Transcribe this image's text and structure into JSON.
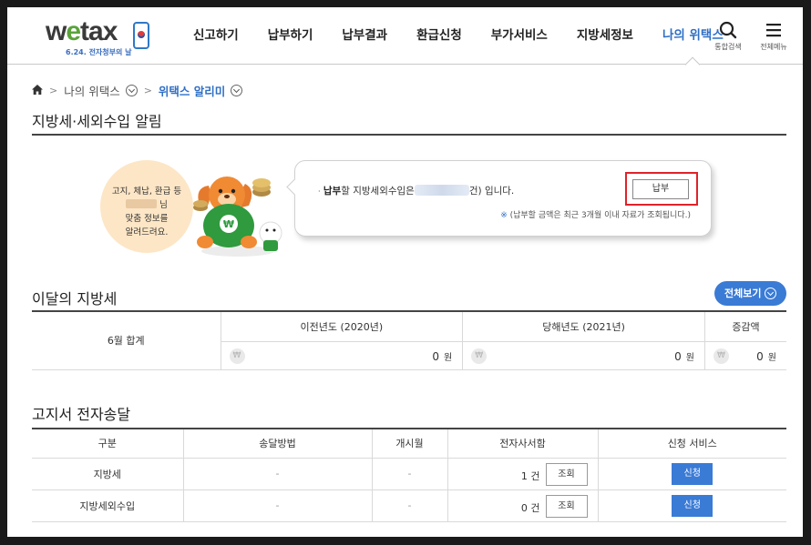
{
  "header": {
    "logo_word_pre": "w",
    "logo_word_e": "e",
    "logo_word_post": "tax",
    "logo_sub": "6.24. 전자청부의 날",
    "nav": [
      "신고하기",
      "납부하기",
      "납부결과",
      "환급신청",
      "부가서비스",
      "지방세정보",
      "나의 위택스"
    ],
    "active_nav": "나의 위택스",
    "search_label": "통합검색",
    "menu_label": "전체메뉴"
  },
  "breadcrumb": {
    "level1": "나의 위택스",
    "current": "위택스 알리미"
  },
  "notice": {
    "section_title": "지방세·세외수입 알림",
    "bubble_line1": "고지, 체납, 환급 등",
    "bubble_line2": "님",
    "bubble_line3": "맞춤 정보를",
    "bubble_line4": "알려드려요.",
    "pay_bold": "납부",
    "pay_text_pre": "할 지방세외수입은",
    "pay_text_post": "건) 입니다.",
    "note_mark": "※",
    "note_text": "(납부할 금액은 최근 3개월 이내 자료가 조회됩니다.)",
    "pay_button": "납부"
  },
  "this_month": {
    "section_title": "이달의 지방세",
    "view_all": "전체보기",
    "row_label": "6월 합계",
    "columns": [
      {
        "header": "이전년도 (2020년)",
        "amount": "0",
        "unit": "원"
      },
      {
        "header": "당해년도 (2021년)",
        "amount": "0",
        "unit": "원"
      },
      {
        "header": "증감액",
        "amount": "0",
        "unit": "원"
      }
    ],
    "won_symbol": "₩"
  },
  "delivery": {
    "section_title": "고지서 전자송달",
    "headers": [
      "구분",
      "송달방법",
      "개시월",
      "전자사서함",
      "신청 서비스"
    ],
    "rows": [
      {
        "type": "지방세",
        "method": "-",
        "start": "-",
        "count": "1 건",
        "view": "조회",
        "apply": "신청"
      },
      {
        "type": "지방세외수입",
        "method": "-",
        "start": "-",
        "count": "0 건",
        "view": "조회",
        "apply": "신청"
      }
    ]
  },
  "colors": {
    "accent": "#2e6fc6",
    "button_blue": "#3a7bd5",
    "highlight_red": "#e0222a",
    "bubble_peach": "#fde6c6",
    "mascot_green": "#2f9a3e"
  }
}
